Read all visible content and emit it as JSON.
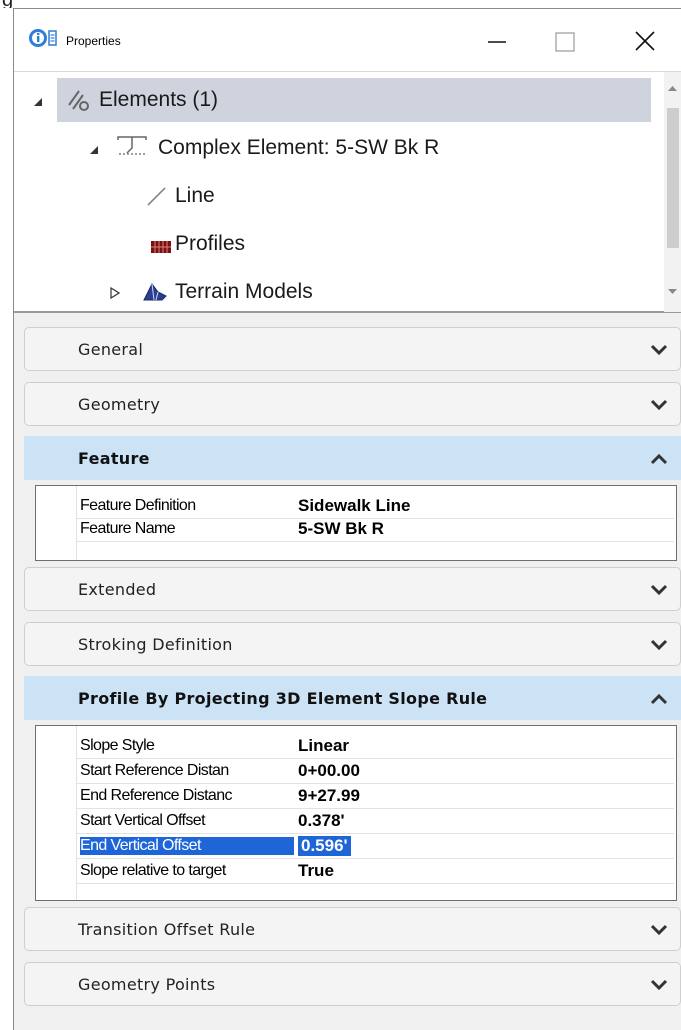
{
  "top_stub": "g",
  "window": {
    "title": "Properties",
    "icon": "properties-icon",
    "controls": [
      "minimize-icon",
      "maximize-icon",
      "close-icon"
    ]
  },
  "tree": {
    "items": [
      {
        "label": "Elements (1)",
        "icon": "elements-icon",
        "expander": "expanded",
        "selected": true
      },
      {
        "label": "Complex Element: 5-SW Bk R",
        "icon": "complex-element-icon",
        "expander": "expanded"
      },
      {
        "label": "Line",
        "icon": "line-icon"
      },
      {
        "label": "Profiles",
        "icon": "profiles-icon"
      },
      {
        "label": "Terrain Models",
        "icon": "terrain-models-icon",
        "expander": "collapsed"
      }
    ]
  },
  "sections": {
    "general": {
      "label": "General",
      "state": "collapsed"
    },
    "geometry": {
      "label": "Geometry",
      "state": "collapsed"
    },
    "feature": {
      "label": "Feature",
      "state": "expanded",
      "rows": [
        {
          "name": "Feature Definition",
          "value": "Sidewalk Line"
        },
        {
          "name": "Feature Name",
          "value": "5-SW Bk R"
        }
      ]
    },
    "extended": {
      "label": "Extended",
      "state": "collapsed"
    },
    "stroking": {
      "label": "Stroking Definition",
      "state": "collapsed"
    },
    "profile_rule": {
      "label": "Profile By Projecting 3D Element Slope Rule",
      "state": "expanded",
      "rows": [
        {
          "name": "Slope Style",
          "value": "Linear"
        },
        {
          "name": "Start Reference Distan",
          "value": "0+00.00"
        },
        {
          "name": "End Reference Distanc",
          "value": "9+27.99"
        },
        {
          "name": "Start Vertical Offset",
          "value": "0.378'"
        },
        {
          "name": "End Vertical Offset",
          "value": "0.596'",
          "selected": true
        },
        {
          "name": "Slope relative to target",
          "value": "True"
        }
      ]
    },
    "transition": {
      "label": "Transition Offset Rule",
      "state": "collapsed"
    },
    "geometry_points": {
      "label": "Geometry Points",
      "state": "collapsed"
    }
  },
  "colors": {
    "selection": "#1e66d8",
    "section_open": "#cce2f5",
    "tree_selected": "#cfd3de"
  }
}
